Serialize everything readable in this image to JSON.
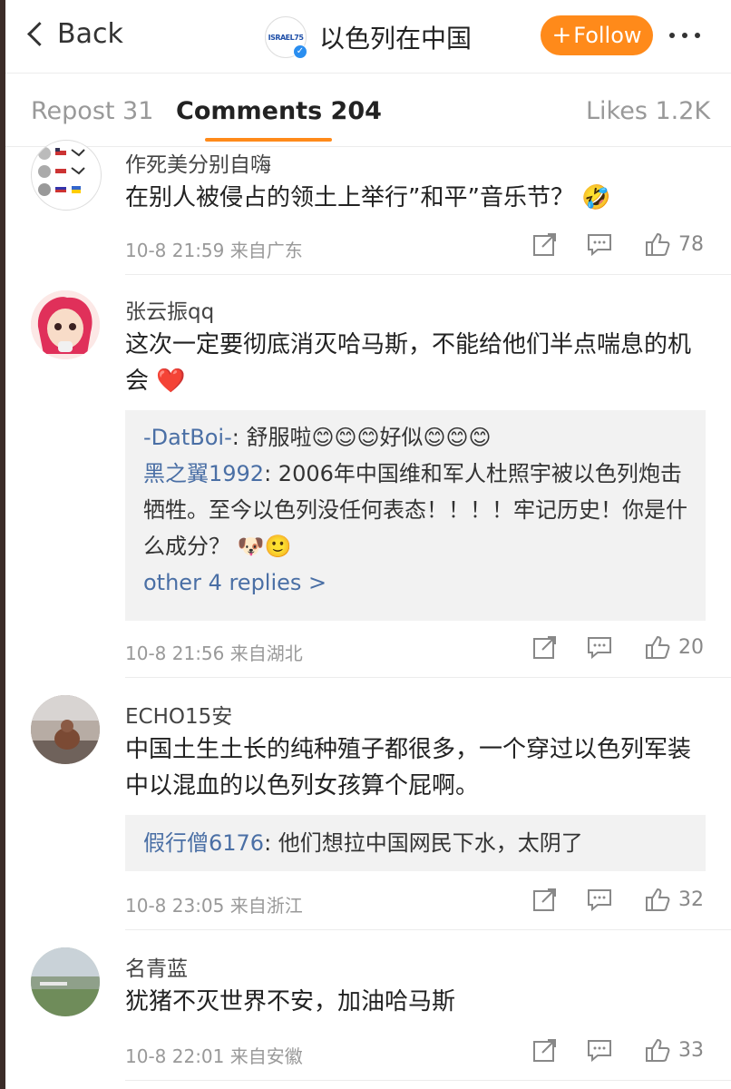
{
  "navbar": {
    "back_label": "Back",
    "logo_text": "ISRAEL75",
    "title": "以色列在中国",
    "follow_label": "Follow",
    "follow_plus": "+"
  },
  "tabs": {
    "repost": "Repost 31",
    "comments": "Comments 204",
    "likes": "Likes 1.2K"
  },
  "comments": [
    {
      "name": "作死美分别自嗨",
      "text": "在别人被侵占的领土上举行”和平”音乐节？ 🤣",
      "time": "10-8 21:59",
      "location": "来自广东",
      "likes": "78"
    },
    {
      "name": "张云振qq",
      "text": "这次一定要彻底消灭哈马斯，不能给他们半点喘息的机会 ❤️",
      "time": "10-8 21:56",
      "location": "来自湖北",
      "likes": "20",
      "replies": [
        {
          "user": "-DatBoi-",
          "text": ": 舒服啦😊😊😊好似😊😊😊"
        },
        {
          "user": "黑之翼1992",
          "text": ": 2006年中国维和军人杜照宇被以色列炮击牺牲。至今以色列没任何表态！！！！牢记历史！你是什么成分？ 🐶🙂"
        }
      ],
      "more_replies": "other 4 replies >"
    },
    {
      "name": "ECHO15安",
      "text": "中国土生土长的纯种殖子都很多，一个穿过以色列军装中以混血的以色列女孩算个屁啊。",
      "time": "10-8 23:05",
      "location": "来自浙江",
      "likes": "32",
      "replies": [
        {
          "user": "假行僧6176",
          "text": ": 他们想拉中国网民下水，太阴了"
        }
      ]
    },
    {
      "name": "名青蓝",
      "text": "犹猪不灭世界不安，加油哈马斯",
      "time": "10-8 22:01",
      "location": "来自安徽",
      "likes": "33"
    }
  ],
  "colors": {
    "accent": "#ff8a1a",
    "link": "#4a6fa5"
  },
  "icons": [
    "back-chevron-icon",
    "verified-icon",
    "more-icon",
    "share-icon",
    "comment-icon",
    "like-icon"
  ]
}
